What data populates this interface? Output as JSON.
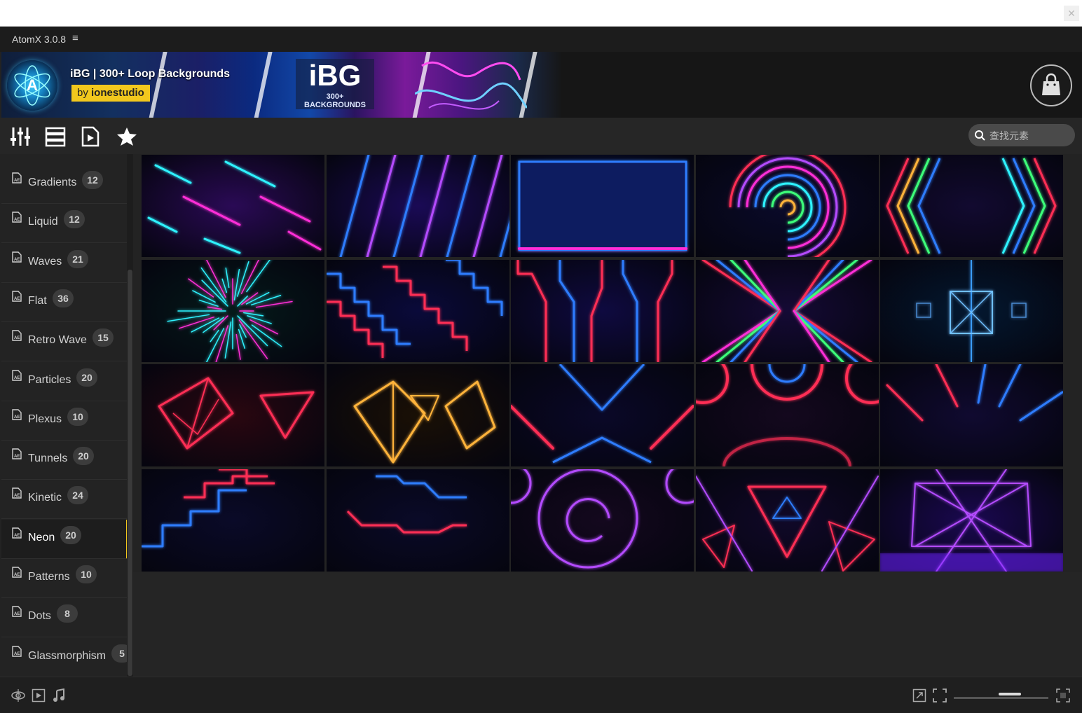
{
  "app": {
    "title": "AtomX 3.0.8"
  },
  "banner": {
    "title": "iBG | 300+ Loop Backgrounds",
    "by_prefix": "by",
    "author": "ionestudio",
    "art_title": "iBG",
    "art_subtitle": "300+ BACKGROUNDS"
  },
  "toolbar": {
    "icons": [
      "sliders-icon",
      "list-icon",
      "media-file-icon",
      "star-icon"
    ]
  },
  "search": {
    "placeholder": "查找元素"
  },
  "sidebar": {
    "active": "Neon",
    "categories": [
      {
        "label": "Gradients",
        "count": "12"
      },
      {
        "label": "Liquid",
        "count": "12"
      },
      {
        "label": "Waves",
        "count": "21"
      },
      {
        "label": "Flat",
        "count": "36"
      },
      {
        "label": "Retro Wave",
        "count": "15"
      },
      {
        "label": "Particles",
        "count": "20"
      },
      {
        "label": "Plexus",
        "count": "10"
      },
      {
        "label": "Tunnels",
        "count": "20"
      },
      {
        "label": "Kinetic",
        "count": "24"
      },
      {
        "label": "Neon",
        "count": "20"
      },
      {
        "label": "Patterns",
        "count": "10"
      },
      {
        "label": "Dots",
        "count": "8"
      },
      {
        "label": "Glassmorphism",
        "count": "5"
      }
    ]
  },
  "grid": {
    "item_count": 20,
    "palette": {
      "cyan": "#2ff3ff",
      "magenta": "#ff2fd8",
      "blue": "#2f7dff",
      "purple": "#b44cff",
      "red": "#ff2f55",
      "orange": "#ffb33a",
      "green": "#3cff7a"
    }
  },
  "statusbar": {
    "left_icons": [
      "preview-settings-icon",
      "video-icon",
      "music-icon"
    ],
    "right_icons": [
      "expand-icon",
      "fit-icon",
      "fullscreen-icon"
    ],
    "zoom_level": 0.5
  }
}
